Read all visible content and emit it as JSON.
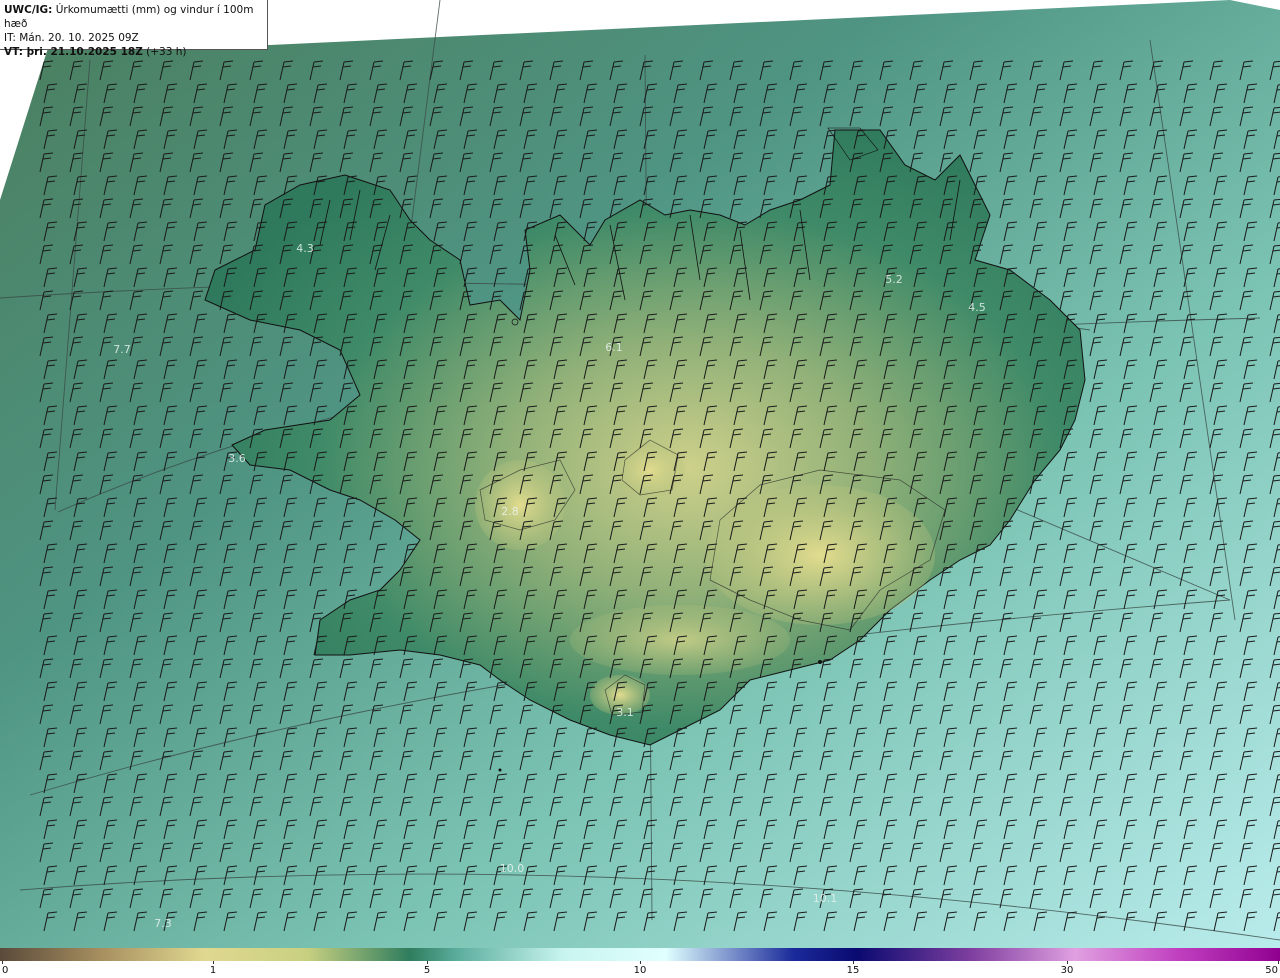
{
  "header": {
    "line1_bold": "UWC/IG:",
    "line1_rest": " Úrkomumætti (mm) og vindur í 100m hæð",
    "line2": "IT: Mán. 20. 10. 2025 09Z",
    "line3_bold": "VT: þri. 21.10.2025 18Z",
    "line3_rest": " (+33 h)"
  },
  "map_values": [
    "4.3",
    "7.7",
    "3.6",
    "2.8",
    "3.1",
    "10.0",
    "7.3",
    "10.1",
    "5.2",
    "4.5",
    "6.1"
  ],
  "colorbar": {
    "ticks": [
      "0",
      "1",
      "5",
      "10",
      "15",
      "30",
      "50"
    ],
    "colors": [
      "#5a4a3a",
      "#a89060",
      "#e0d890",
      "#c8d080",
      "#2e7d5e",
      "#5fb0a0",
      "#c8f4f0",
      "#e0ffff",
      "#1a2a9a",
      "#0a0a70",
      "#8040a0",
      "#e0a0e0",
      "#c040c0",
      "#900090"
    ]
  },
  "wind": {
    "direction": "westerly",
    "barb_color": "#1a1a1a"
  },
  "colors": {
    "sea_dark": "#4f8f7a",
    "sea_light": "#b8ece8",
    "land_green": "#2e7d5e",
    "land_yellow": "#cfd28a",
    "coast": "#111111"
  }
}
